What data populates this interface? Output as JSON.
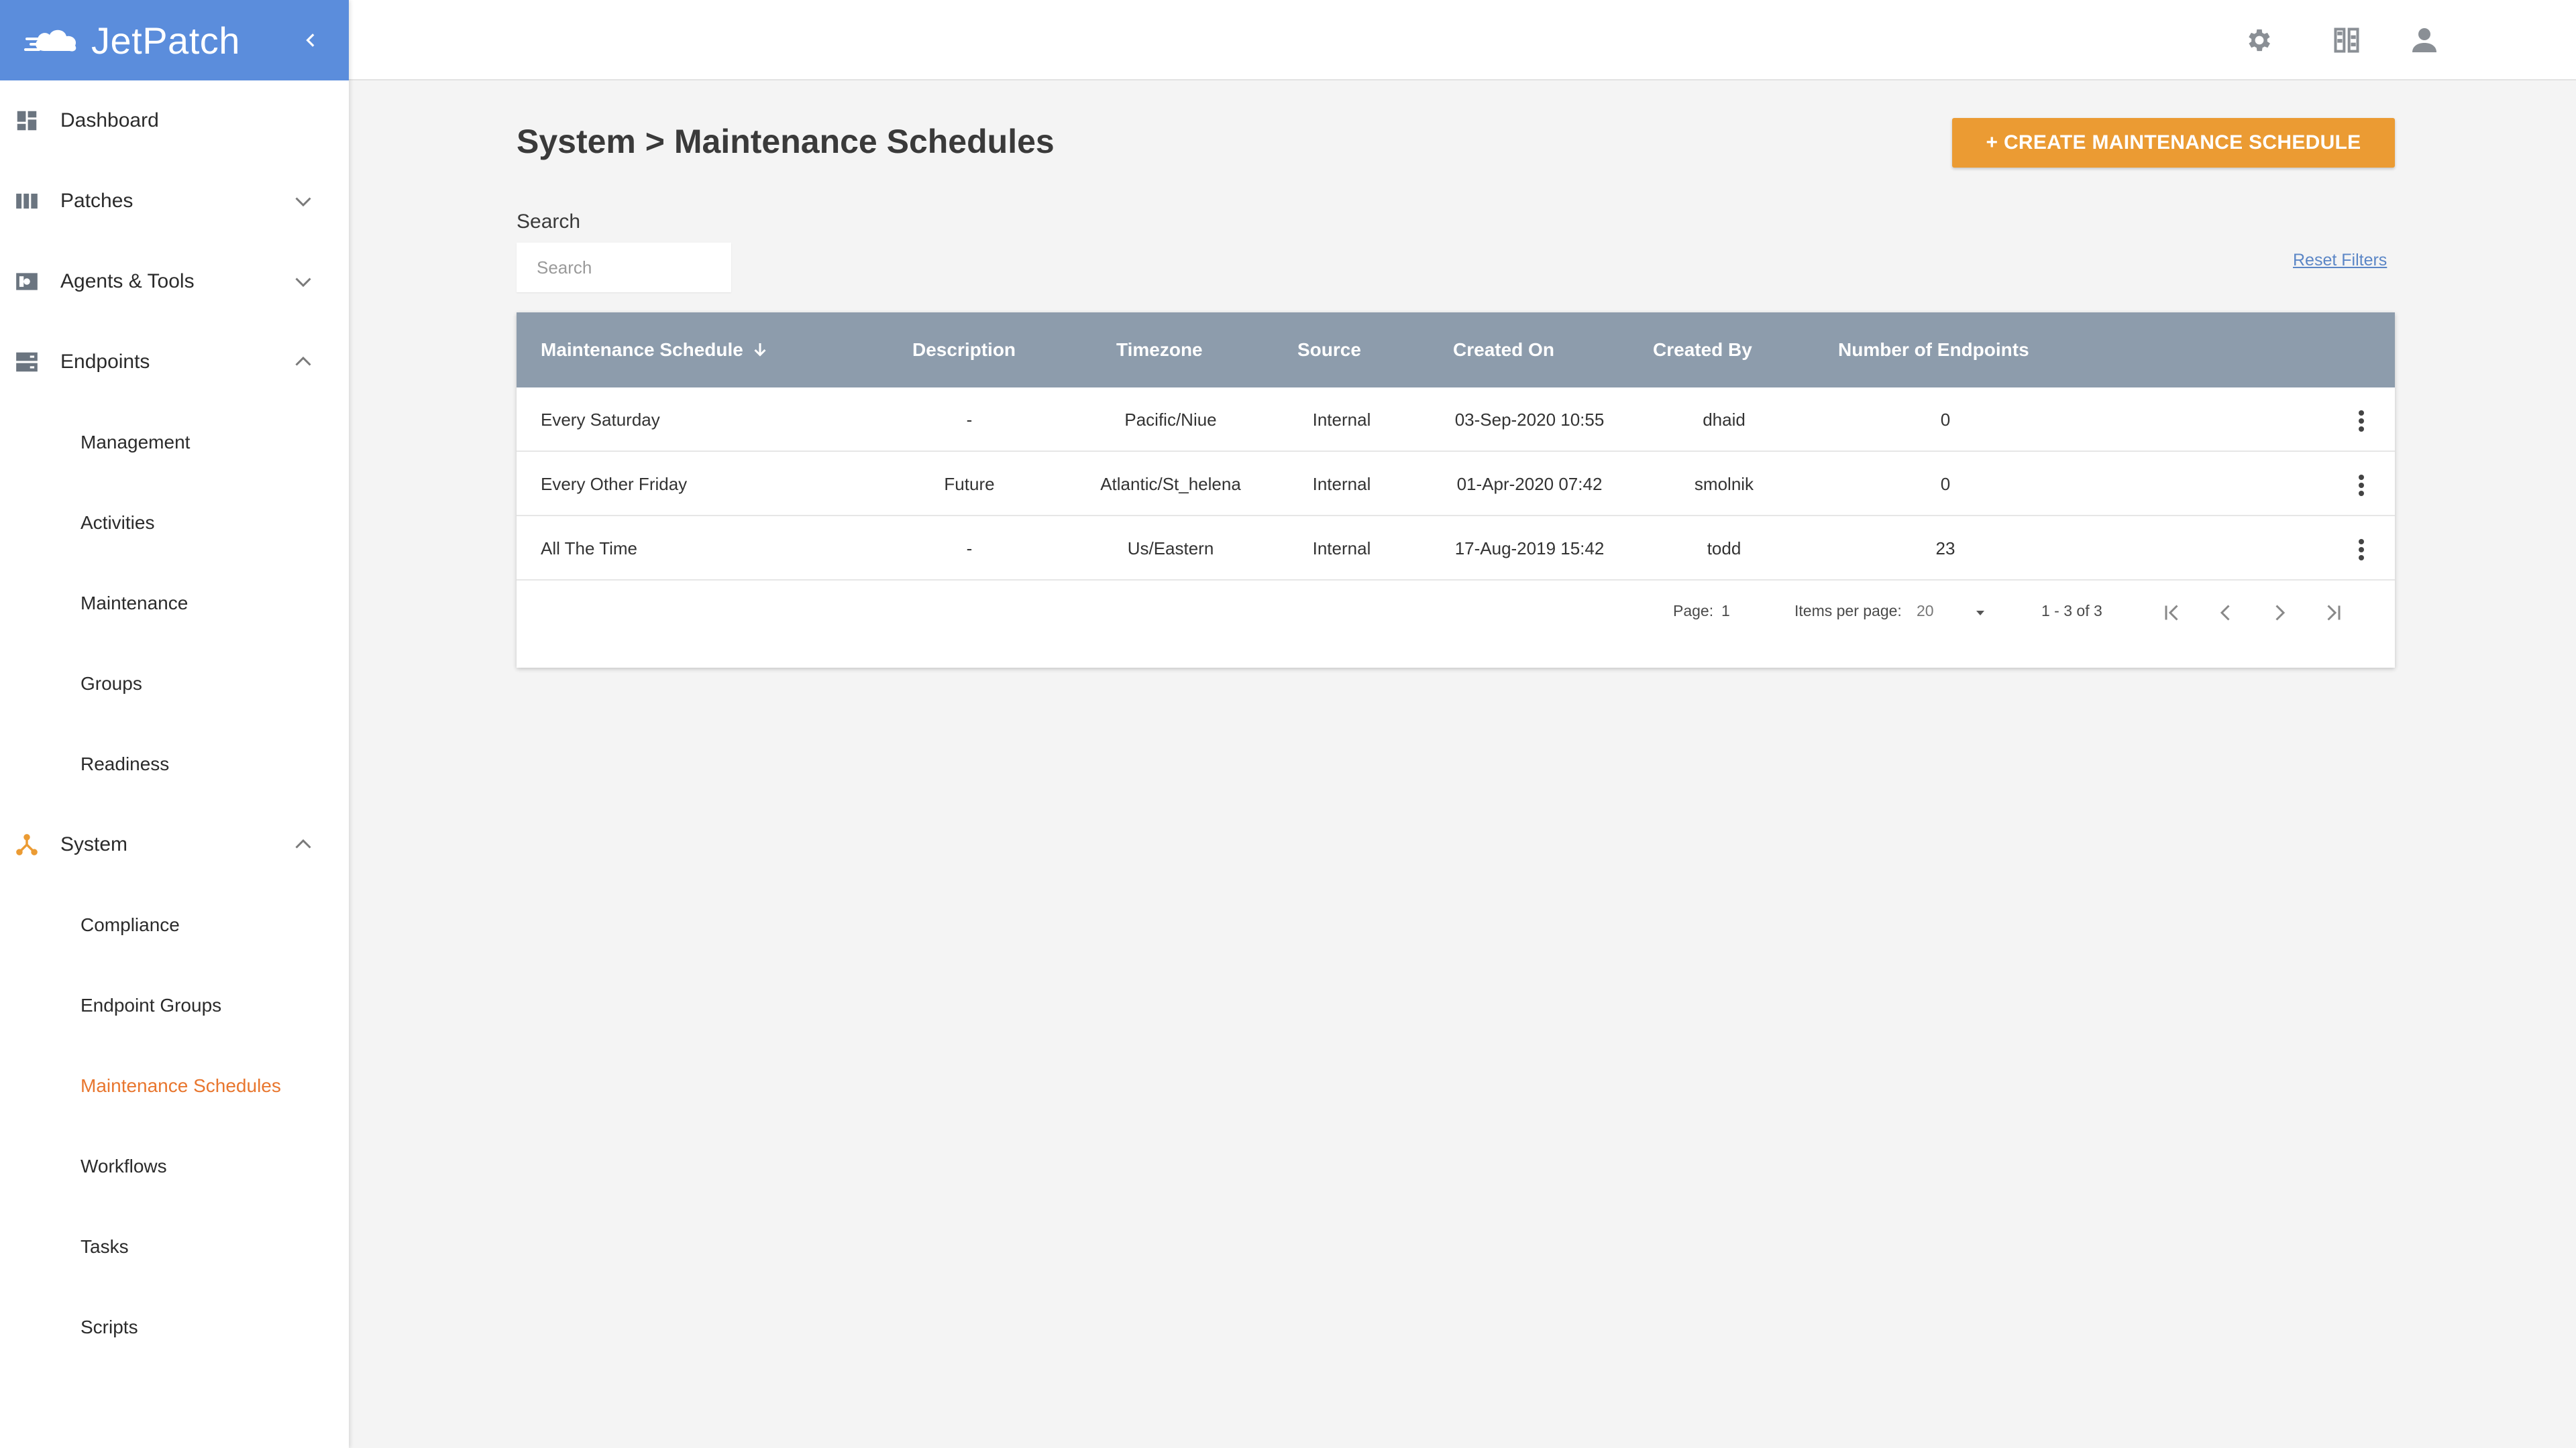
{
  "app": {
    "name": "JetPatch"
  },
  "colors": {
    "brand": "#5b8ddc",
    "accent": "#eb9b33",
    "active_nav": "#e8762e",
    "table_header": "#8d9cac",
    "link": "#5b86c6"
  },
  "sidebar": {
    "items": [
      {
        "label": "Dashboard",
        "icon": "dashboard-icon"
      },
      {
        "label": "Patches",
        "icon": "columns-icon",
        "expanded": false
      },
      {
        "label": "Agents & Tools",
        "icon": "agent-tools-icon",
        "expanded": false
      },
      {
        "label": "Endpoints",
        "icon": "server-icon",
        "expanded": true,
        "children": [
          "Management",
          "Activities",
          "Maintenance",
          "Groups",
          "Readiness"
        ]
      },
      {
        "label": "System",
        "icon": "system-hub-icon",
        "expanded": true,
        "children": [
          "Compliance",
          "Endpoint Groups",
          "Maintenance Schedules",
          "Workflows",
          "Tasks",
          "Scripts"
        ]
      }
    ],
    "active_child": "Maintenance Schedules"
  },
  "topbar": {
    "icons": [
      "settings-icon",
      "columns-toggle-icon",
      "user-account-icon"
    ]
  },
  "page": {
    "title": "System > Maintenance Schedules",
    "create_button": "+ CREATE MAINTENANCE SCHEDULE",
    "search_label": "Search",
    "search_placeholder": "Search",
    "reset_filters": "Reset Filters"
  },
  "table": {
    "columns": [
      "Maintenance Schedule",
      "Description",
      "Timezone",
      "Source",
      "Created On",
      "Created By",
      "Number of Endpoints"
    ],
    "sort": {
      "column": "Maintenance Schedule",
      "direction": "descending"
    },
    "rows": [
      [
        "Every Saturday",
        "-",
        "Pacific/Niue",
        "Internal",
        "03-Sep-2020 10:55",
        "dhaid",
        "0"
      ],
      [
        "Every Other Friday",
        "Future",
        "Atlantic/St_helena",
        "Internal",
        "01-Apr-2020 07:42",
        "smolnik",
        "0"
      ],
      [
        "All The Time",
        "-",
        "Us/Eastern",
        "Internal",
        "17-Aug-2019 15:42",
        "todd",
        "23"
      ]
    ]
  },
  "pagination": {
    "page_label": "Page:",
    "page": "1",
    "items_per_page_label": "Items per page:",
    "items_per_page": "20",
    "range": "1 - 3 of 3"
  }
}
